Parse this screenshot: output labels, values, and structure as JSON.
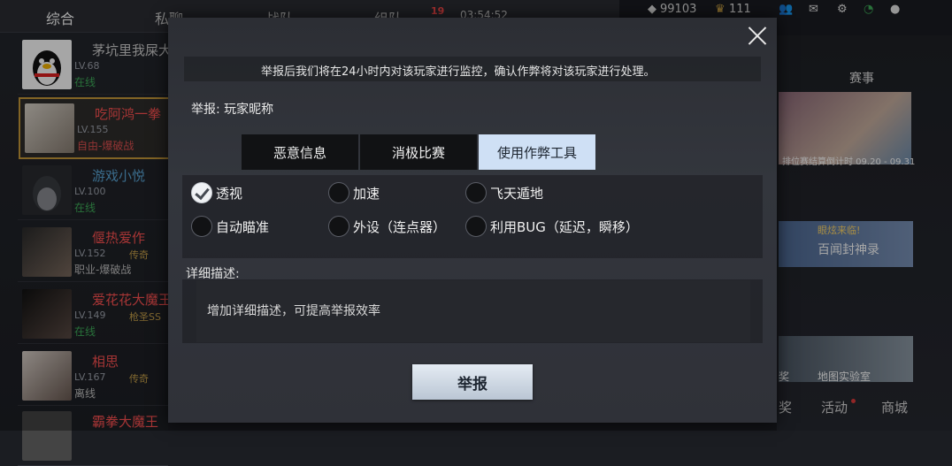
{
  "background": {
    "top_tabs": [
      "综合",
      "私聊",
      "战队",
      "组队"
    ],
    "notif_count": "19",
    "clock": "03:54:52",
    "currency": {
      "coins": "99103",
      "vip": "111"
    },
    "right_panel": {
      "title": "赛事",
      "event_banner_text": "排位赛结算倒计时 09.20 - 09.31",
      "card2_top": "眼炫来临!",
      "card2_title": "百闻封神录",
      "card3_label_a": "奖",
      "card3_label_b": "地图实验室"
    },
    "bottom_nav": [
      "奖",
      "活动",
      "商城"
    ],
    "friends": [
      {
        "name": "茅坑里我屎大",
        "level": "LV.68",
        "status": "在线",
        "rank": ""
      },
      {
        "name": "吃阿鸿一拳",
        "level": "LV.155",
        "status": "自由-爆破战",
        "rank": ""
      },
      {
        "name": "游戏小悦",
        "level": "LV.100",
        "status": "在线",
        "rank": ""
      },
      {
        "name": "偃热爱作",
        "level": "LV.152",
        "status": "职业-爆破战",
        "rank": "传奇"
      },
      {
        "name": "爱花花大魔王",
        "level": "LV.149",
        "status": "在线",
        "rank": "枪圣SS"
      },
      {
        "name": "相思",
        "level": "LV.167",
        "status": "离线",
        "rank": "传奇"
      },
      {
        "name": "霸拳大魔王",
        "level": "",
        "status": "",
        "rank": ""
      }
    ]
  },
  "modal": {
    "notice": "举报后我们将在24小时内对该玩家进行监控，确认作弊将对该玩家进行处理。",
    "report_target": "举报: 玩家昵称",
    "categories": [
      {
        "label": "恶意信息",
        "active": false
      },
      {
        "label": "消极比赛",
        "active": false
      },
      {
        "label": "使用作弊工具",
        "active": true
      }
    ],
    "options": [
      {
        "label": "透视",
        "checked": true
      },
      {
        "label": "加速",
        "checked": false
      },
      {
        "label": "飞天遁地",
        "checked": false
      },
      {
        "label": "自动瞄准",
        "checked": false
      },
      {
        "label": "外设（连点器）",
        "checked": false
      },
      {
        "label": "利用BUG（延迟，瞬移）",
        "checked": false
      }
    ],
    "detail_label": "详细描述:",
    "detail_placeholder": "增加详细描述，可提高举报效率",
    "submit_label": "举报"
  }
}
